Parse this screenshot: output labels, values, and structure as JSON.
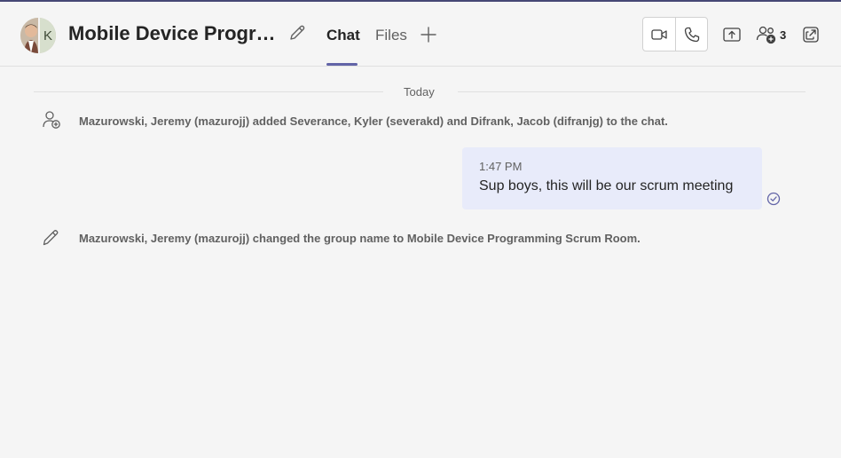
{
  "header": {
    "avatar_letter": "K",
    "title": "Mobile Device Programming Scrum Room",
    "tabs": [
      {
        "label": "Chat",
        "active": true
      },
      {
        "label": "Files",
        "active": false
      }
    ],
    "people_count": "3",
    "accent_color": "#6264a7"
  },
  "chat": {
    "date_divider": "Today",
    "events": [
      {
        "icon": "person-add-icon",
        "text": "Mazurowski, Jeremy (mazurojj) added Severance, Kyler (severakd) and Difrank, Jacob (difranjg) to the chat."
      },
      {
        "icon": "pencil-icon",
        "text": "Mazurowski, Jeremy (mazurojj) changed the group name to Mobile Device Programming Scrum Room."
      }
    ],
    "message": {
      "time": "1:47 PM",
      "text": "Sup boys, this will be our scrum meeting",
      "status_icon": "read-check-icon"
    }
  }
}
